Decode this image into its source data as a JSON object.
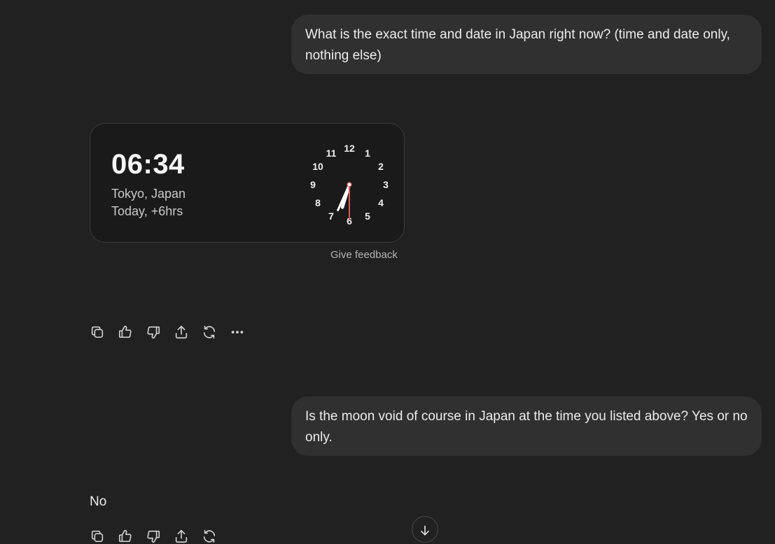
{
  "messages": {
    "user_1": "What is the exact time and date in Japan right now? (time and date only, nothing else)",
    "user_2": "Is the moon void of course in Japan at the time you listed above? Yes or no only.",
    "assistant_2": "No"
  },
  "clock_widget": {
    "time": "06:34",
    "location": "Tokyo, Japan",
    "relative": "Today, +6hrs",
    "dial_numbers": [
      "12",
      "1",
      "2",
      "3",
      "4",
      "5",
      "6",
      "7",
      "8",
      "9",
      "10",
      "11"
    ],
    "analog_time": {
      "hour": 6,
      "minute": 34
    },
    "feedback_link": "Give feedback"
  },
  "action_icons": [
    "copy-icon",
    "thumbs-up-icon",
    "thumbs-down-icon",
    "share-icon",
    "regenerate-icon",
    "more-icon"
  ],
  "colors": {
    "background": "#212121",
    "user_bubble": "#303030",
    "card_background": "#1a1a1a",
    "second_hand": "#e05555"
  }
}
